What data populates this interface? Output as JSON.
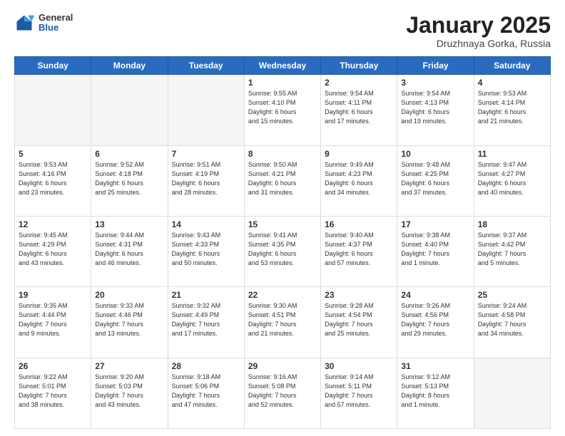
{
  "header": {
    "logo_general": "General",
    "logo_blue": "Blue",
    "month_title": "January 2025",
    "subtitle": "Druzhnaya Gorka, Russia"
  },
  "days_of_week": [
    "Sunday",
    "Monday",
    "Tuesday",
    "Wednesday",
    "Thursday",
    "Friday",
    "Saturday"
  ],
  "weeks": [
    [
      {
        "day": "",
        "info": ""
      },
      {
        "day": "",
        "info": ""
      },
      {
        "day": "",
        "info": ""
      },
      {
        "day": "1",
        "info": "Sunrise: 9:55 AM\nSunset: 4:10 PM\nDaylight: 6 hours\nand 15 minutes."
      },
      {
        "day": "2",
        "info": "Sunrise: 9:54 AM\nSunset: 4:11 PM\nDaylight: 6 hours\nand 17 minutes."
      },
      {
        "day": "3",
        "info": "Sunrise: 9:54 AM\nSunset: 4:13 PM\nDaylight: 6 hours\nand 19 minutes."
      },
      {
        "day": "4",
        "info": "Sunrise: 9:53 AM\nSunset: 4:14 PM\nDaylight: 6 hours\nand 21 minutes."
      }
    ],
    [
      {
        "day": "5",
        "info": "Sunrise: 9:53 AM\nSunset: 4:16 PM\nDaylight: 6 hours\nand 23 minutes."
      },
      {
        "day": "6",
        "info": "Sunrise: 9:52 AM\nSunset: 4:18 PM\nDaylight: 6 hours\nand 25 minutes."
      },
      {
        "day": "7",
        "info": "Sunrise: 9:51 AM\nSunset: 4:19 PM\nDaylight: 6 hours\nand 28 minutes."
      },
      {
        "day": "8",
        "info": "Sunrise: 9:50 AM\nSunset: 4:21 PM\nDaylight: 6 hours\nand 31 minutes."
      },
      {
        "day": "9",
        "info": "Sunrise: 9:49 AM\nSunset: 4:23 PM\nDaylight: 6 hours\nand 34 minutes."
      },
      {
        "day": "10",
        "info": "Sunrise: 9:48 AM\nSunset: 4:25 PM\nDaylight: 6 hours\nand 37 minutes."
      },
      {
        "day": "11",
        "info": "Sunrise: 9:47 AM\nSunset: 4:27 PM\nDaylight: 6 hours\nand 40 minutes."
      }
    ],
    [
      {
        "day": "12",
        "info": "Sunrise: 9:45 AM\nSunset: 4:29 PM\nDaylight: 6 hours\nand 43 minutes."
      },
      {
        "day": "13",
        "info": "Sunrise: 9:44 AM\nSunset: 4:31 PM\nDaylight: 6 hours\nand 46 minutes."
      },
      {
        "day": "14",
        "info": "Sunrise: 9:43 AM\nSunset: 4:33 PM\nDaylight: 6 hours\nand 50 minutes."
      },
      {
        "day": "15",
        "info": "Sunrise: 9:41 AM\nSunset: 4:35 PM\nDaylight: 6 hours\nand 53 minutes."
      },
      {
        "day": "16",
        "info": "Sunrise: 9:40 AM\nSunset: 4:37 PM\nDaylight: 6 hours\nand 57 minutes."
      },
      {
        "day": "17",
        "info": "Sunrise: 9:38 AM\nSunset: 4:40 PM\nDaylight: 7 hours\nand 1 minute."
      },
      {
        "day": "18",
        "info": "Sunrise: 9:37 AM\nSunset: 4:42 PM\nDaylight: 7 hours\nand 5 minutes."
      }
    ],
    [
      {
        "day": "19",
        "info": "Sunrise: 9:35 AM\nSunset: 4:44 PM\nDaylight: 7 hours\nand 9 minutes."
      },
      {
        "day": "20",
        "info": "Sunrise: 9:33 AM\nSunset: 4:46 PM\nDaylight: 7 hours\nand 13 minutes."
      },
      {
        "day": "21",
        "info": "Sunrise: 9:32 AM\nSunset: 4:49 PM\nDaylight: 7 hours\nand 17 minutes."
      },
      {
        "day": "22",
        "info": "Sunrise: 9:30 AM\nSunset: 4:51 PM\nDaylight: 7 hours\nand 21 minutes."
      },
      {
        "day": "23",
        "info": "Sunrise: 9:28 AM\nSunset: 4:54 PM\nDaylight: 7 hours\nand 25 minutes."
      },
      {
        "day": "24",
        "info": "Sunrise: 9:26 AM\nSunset: 4:56 PM\nDaylight: 7 hours\nand 29 minutes."
      },
      {
        "day": "25",
        "info": "Sunrise: 9:24 AM\nSunset: 4:58 PM\nDaylight: 7 hours\nand 34 minutes."
      }
    ],
    [
      {
        "day": "26",
        "info": "Sunrise: 9:22 AM\nSunset: 5:01 PM\nDaylight: 7 hours\nand 38 minutes."
      },
      {
        "day": "27",
        "info": "Sunrise: 9:20 AM\nSunset: 5:03 PM\nDaylight: 7 hours\nand 43 minutes."
      },
      {
        "day": "28",
        "info": "Sunrise: 9:18 AM\nSunset: 5:06 PM\nDaylight: 7 hours\nand 47 minutes."
      },
      {
        "day": "29",
        "info": "Sunrise: 9:16 AM\nSunset: 5:08 PM\nDaylight: 7 hours\nand 52 minutes."
      },
      {
        "day": "30",
        "info": "Sunrise: 9:14 AM\nSunset: 5:11 PM\nDaylight: 7 hours\nand 57 minutes."
      },
      {
        "day": "31",
        "info": "Sunrise: 9:12 AM\nSunset: 5:13 PM\nDaylight: 8 hours\nand 1 minute."
      },
      {
        "day": "",
        "info": ""
      }
    ]
  ]
}
